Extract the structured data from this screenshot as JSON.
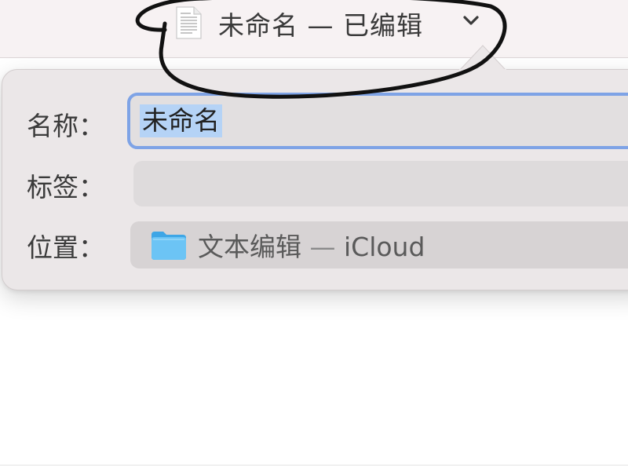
{
  "window": {
    "title": "未命名 — 已编辑",
    "doc_icon": "document-icon",
    "chevron_icon": "chevron-down-icon"
  },
  "popover": {
    "name": {
      "label": "名称：",
      "value": "未命名"
    },
    "tags": {
      "label": "标签：",
      "value": ""
    },
    "location": {
      "label": "位置：",
      "folder_icon": "folder-icon",
      "folder_name": "文本编辑",
      "separator": " — ",
      "service": "iCloud"
    }
  },
  "colors": {
    "focus_ring": "#7ea3e6",
    "selection": "#b5d3f6",
    "folder": "#5ab8f0",
    "annotation": "#111111"
  }
}
